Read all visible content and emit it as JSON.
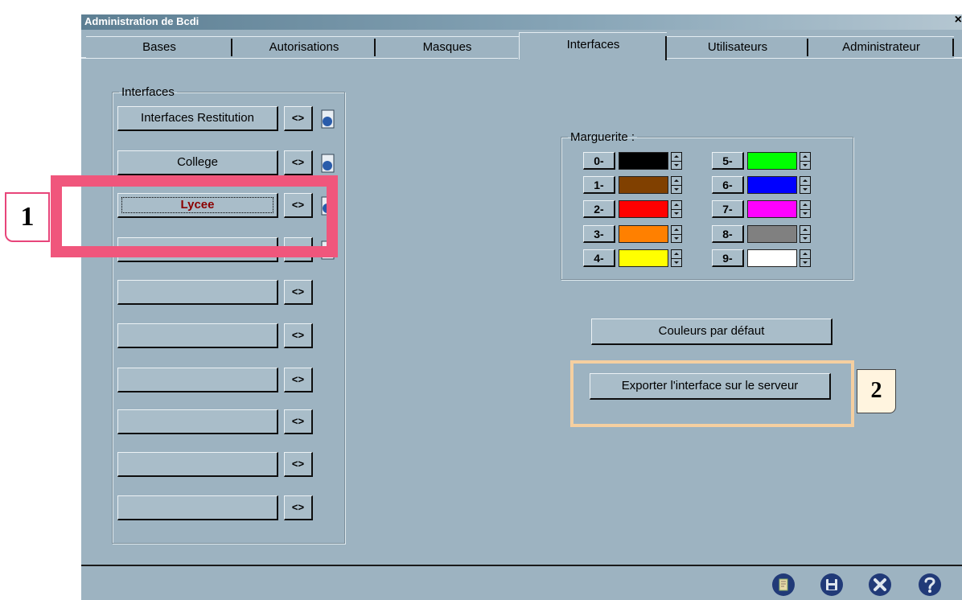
{
  "window": {
    "title": "Administration de Bcdi",
    "close_glyph": "×"
  },
  "tabs": [
    {
      "label": "Bases"
    },
    {
      "label": "Autorisations"
    },
    {
      "label": "Masques"
    },
    {
      "label": "Interfaces",
      "active": true
    },
    {
      "label": "Utilisateurs"
    },
    {
      "label": "Administrateur"
    }
  ],
  "interfaces": {
    "legend": "Interfaces",
    "items": [
      {
        "label": "Interfaces Restitution",
        "swap": "<>",
        "edit_icon": "edit-document-icon"
      },
      {
        "label": "College",
        "swap": "<>",
        "edit_icon": "edit-document-icon"
      },
      {
        "label": "Lycee",
        "swap": "<>",
        "edit_icon": "edit-document-icon",
        "selected": true
      },
      {
        "label": "",
        "swap": "",
        "edit_icon": "edit-document-icon"
      },
      {
        "label": "",
        "swap": "<>"
      },
      {
        "label": "",
        "swap": "<>"
      },
      {
        "label": "",
        "swap": "<>"
      },
      {
        "label": "",
        "swap": "<>"
      },
      {
        "label": "",
        "swap": "<>"
      },
      {
        "label": "",
        "swap": "<>"
      }
    ]
  },
  "marguerite": {
    "legend": "Marguerite :",
    "colors": [
      {
        "label": "0-",
        "color": "#000000"
      },
      {
        "label": "1-",
        "color": "#804000"
      },
      {
        "label": "2-",
        "color": "#ff0000"
      },
      {
        "label": "3-",
        "color": "#ff8000"
      },
      {
        "label": "4-",
        "color": "#ffff00"
      },
      {
        "label": "5-",
        "color": "#00ff00"
      },
      {
        "label": "6-",
        "color": "#0000ff"
      },
      {
        "label": "7-",
        "color": "#ff00ff"
      },
      {
        "label": "8-",
        "color": "#808080"
      },
      {
        "label": "9-",
        "color": "#ffffff"
      }
    ]
  },
  "buttons": {
    "default_colors": "Couleurs par défaut",
    "export": "Exporter l'interface sur le serveur"
  },
  "toolbar": {
    "icons": [
      "note-icon",
      "save-icon",
      "close-icon",
      "help-icon"
    ]
  },
  "annotations": {
    "callout_1": "1",
    "callout_2": "2",
    "highlight_color_1": "#f0567c",
    "highlight_color_2": "#f5cfa0"
  }
}
